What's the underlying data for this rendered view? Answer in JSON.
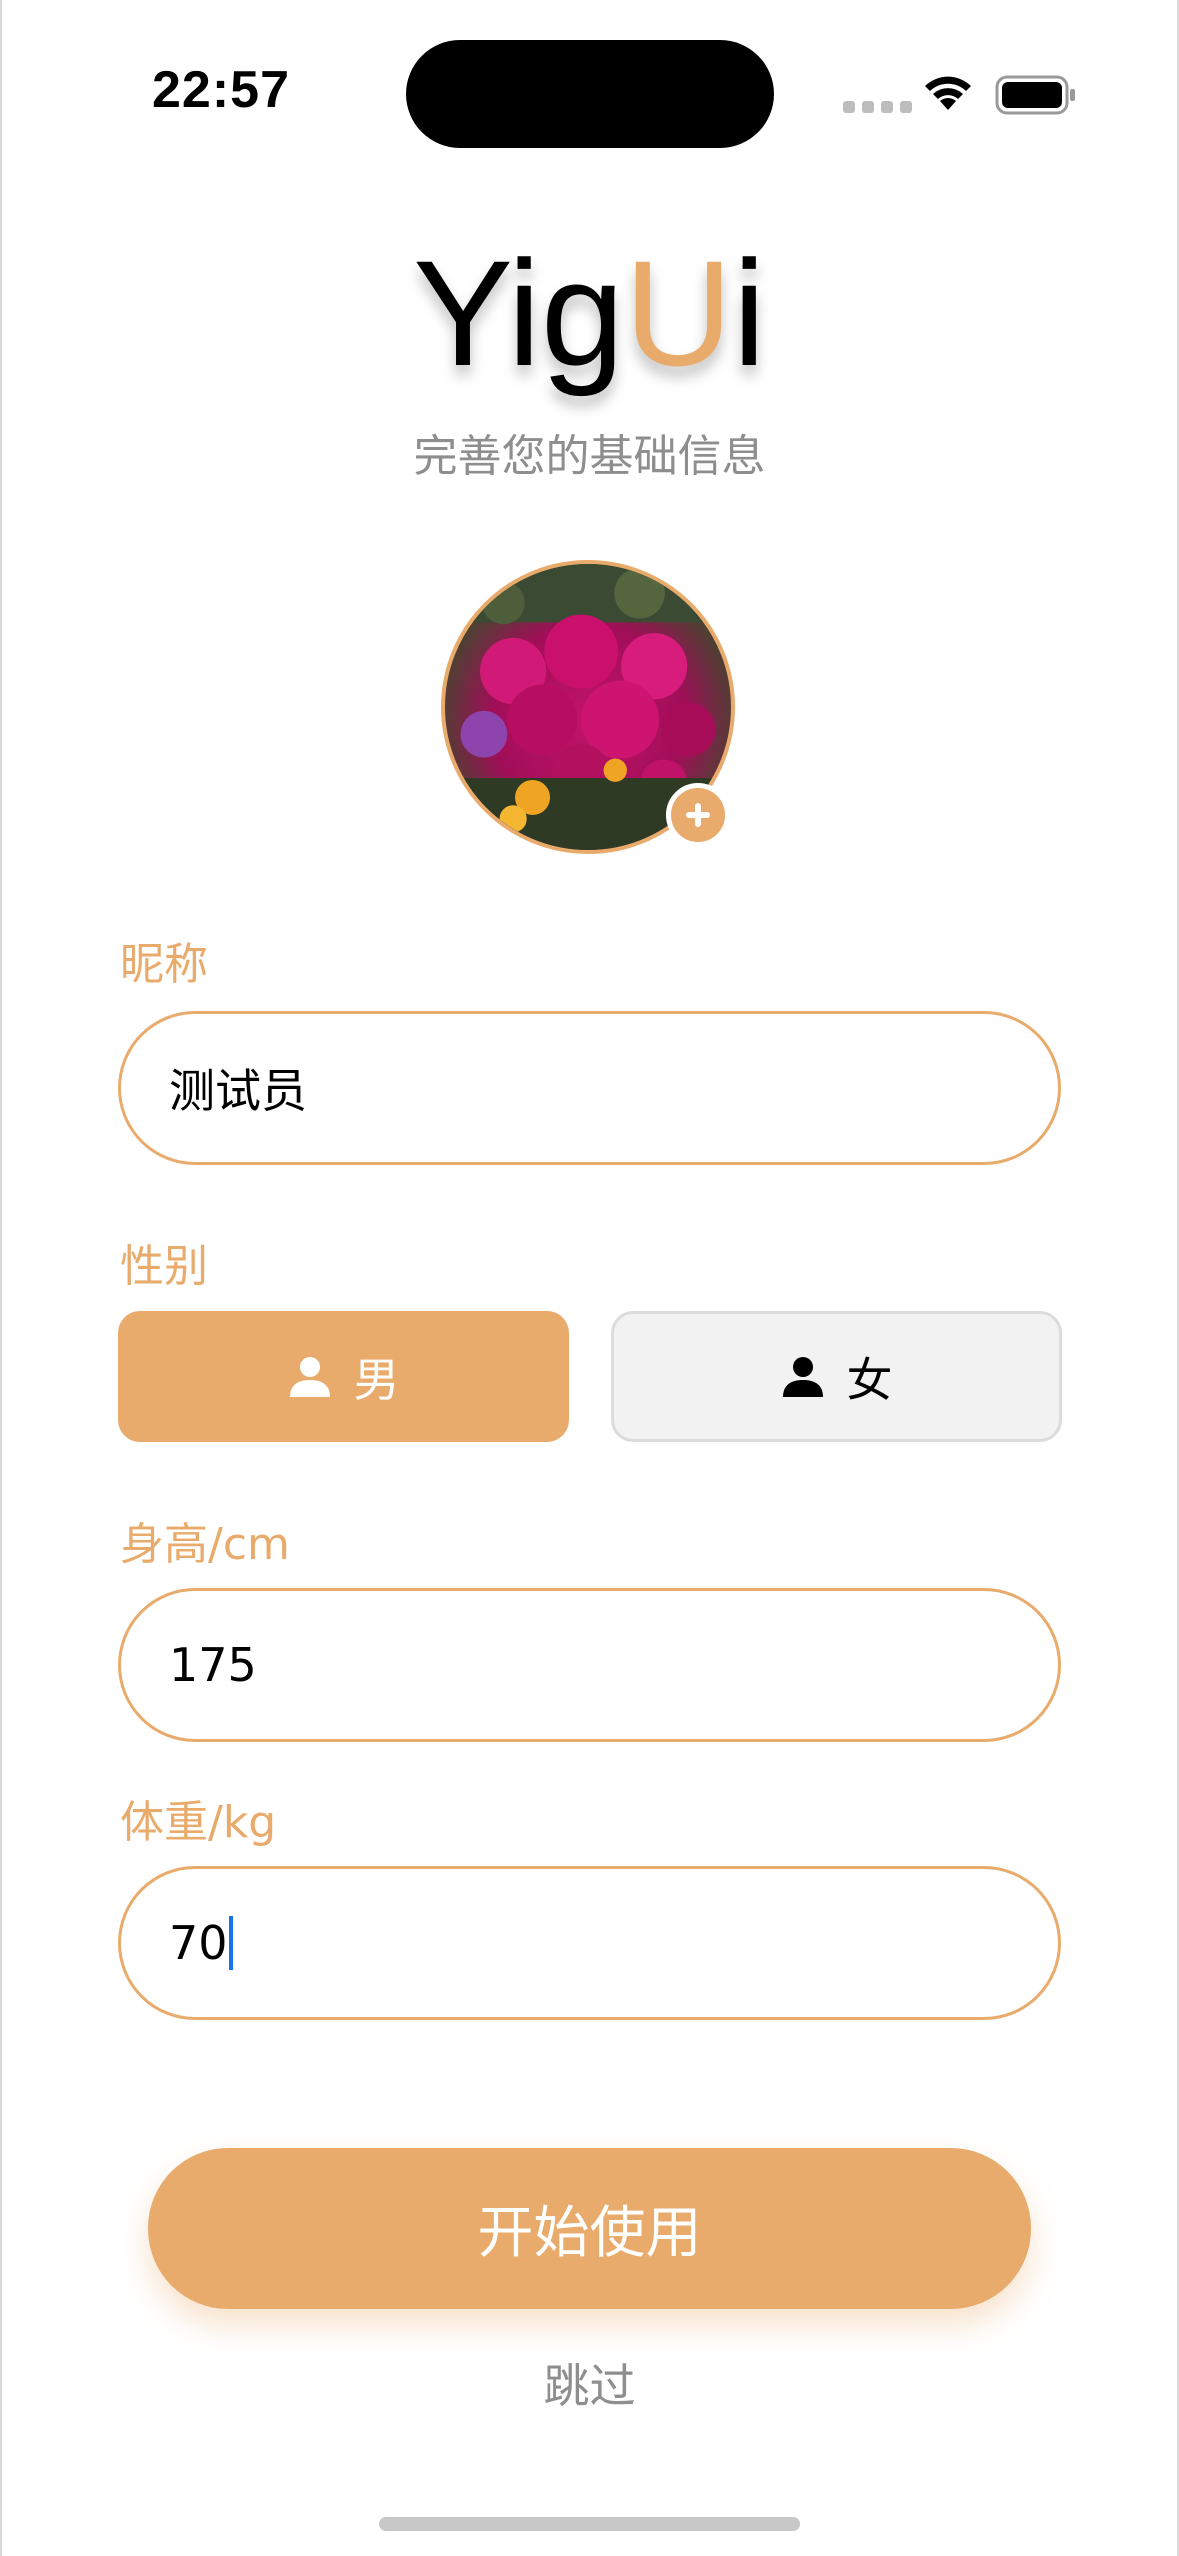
{
  "status_bar": {
    "time": "22:57"
  },
  "header": {
    "logo_part1": "Yig",
    "logo_accent": "U",
    "logo_part2": "i",
    "subtitle": "完善您的基础信息"
  },
  "avatar": {
    "add_icon": "plus-icon"
  },
  "form": {
    "nickname": {
      "label": "昵称",
      "value": "测试员"
    },
    "gender": {
      "label": "性别",
      "options": [
        {
          "label": "男",
          "selected": true
        },
        {
          "label": "女",
          "selected": false
        }
      ]
    },
    "height": {
      "label": "身高/cm",
      "value": "175"
    },
    "weight": {
      "label": "体重/kg",
      "value": "70"
    }
  },
  "actions": {
    "start_label": "开始使用",
    "skip_label": "跳过"
  },
  "colors": {
    "accent": "#e8ab6c",
    "muted": "#8e8e8e",
    "caret": "#1a73e8"
  }
}
